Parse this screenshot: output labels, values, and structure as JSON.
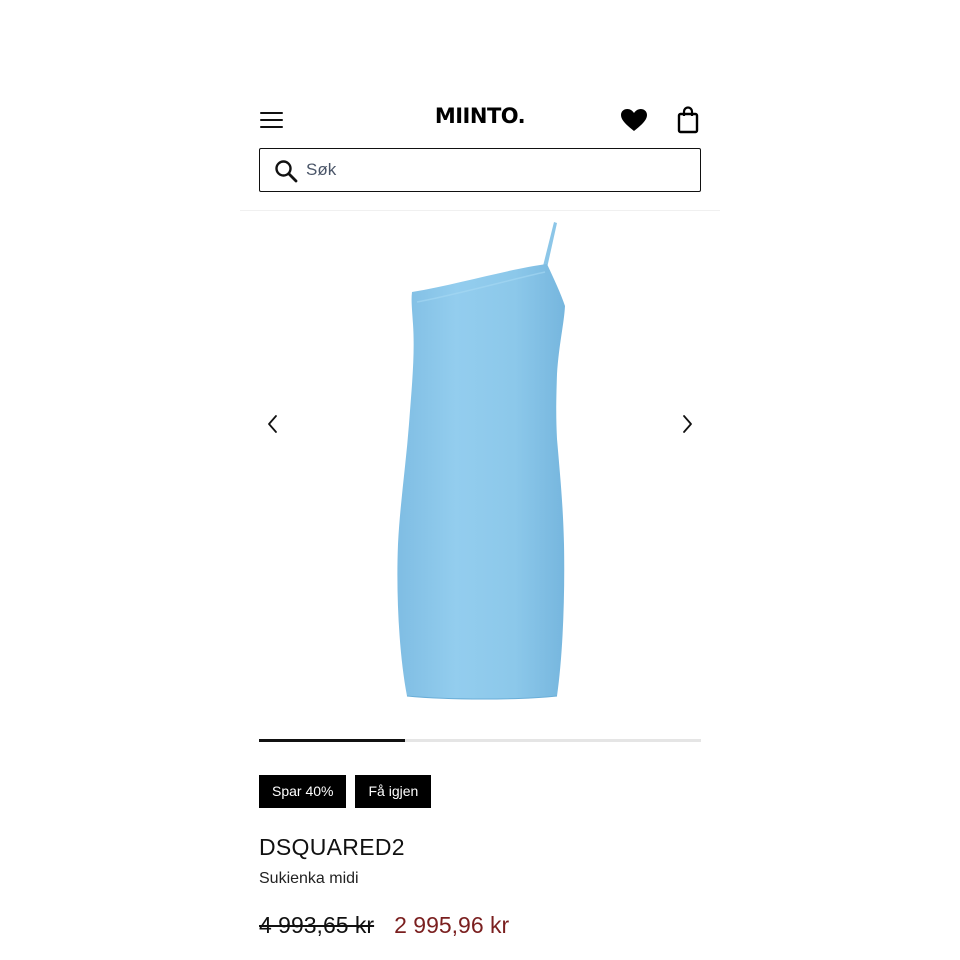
{
  "header": {
    "logo": "MIINTO.",
    "menu_icon": "hamburger-menu-icon",
    "wishlist_icon": "heart-icon",
    "bag_icon": "shopping-bag-icon"
  },
  "search": {
    "placeholder": "Søk",
    "value": "",
    "icon": "search-icon"
  },
  "gallery": {
    "image": "light blue one-shoulder midi dress",
    "prev_icon": "chevron-left-icon",
    "next_icon": "chevron-right-icon",
    "progress": 0.33,
    "dress_color": "#8ec8eb"
  },
  "badges": [
    "Spar 40%",
    "Få igjen"
  ],
  "product": {
    "brand": "DSQUARED2",
    "name": "Sukienka midi",
    "old_price": "4 993,65 kr",
    "new_price": "2 995,96 kr"
  },
  "colors": {
    "sale_price": "#7a1f1f",
    "badge_bg": "#000000"
  }
}
